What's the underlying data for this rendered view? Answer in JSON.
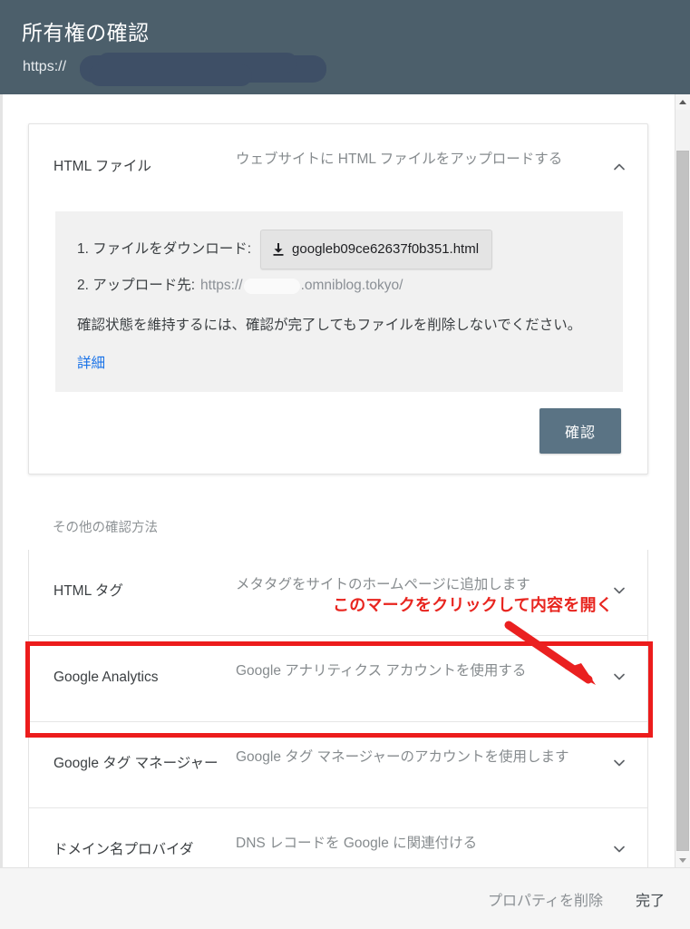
{
  "header": {
    "title": "所有権の確認",
    "url_prefix": "https://",
    "url_redacted": true
  },
  "main_card": {
    "title": "HTML ファイル",
    "description": "ウェブサイトに HTML ファイルをアップロードする",
    "chevron": "chevron-up-icon",
    "steps": {
      "step1_label": "1. ファイルをダウンロード:",
      "download_filename": "googleb09ce62637f0b351.html",
      "download_icon": "download-icon",
      "step2_label": "2. アップロード先:",
      "step2_url_prefix": "https://",
      "step2_url_suffix": ".omniblog.tokyo/"
    },
    "note": "確認状態を維持するには、確認が完了してもファイルを削除しないでください。",
    "details_link": "詳細",
    "confirm_button": "確認"
  },
  "other_methods": {
    "label": "その他の確認方法",
    "rows": [
      {
        "title": "HTML タグ",
        "description": "メタタグをサイトのホームページに追加します",
        "chevron": "chevron-down-icon",
        "highlighted": true
      },
      {
        "title": "Google Analytics",
        "description": "Google アナリティクス アカウントを使用する",
        "chevron": "chevron-down-icon",
        "highlighted": false
      },
      {
        "title": "Google タグ マネージャー",
        "description": "Google タグ マネージャーのアカウントを使用します",
        "chevron": "chevron-down-icon",
        "highlighted": false
      },
      {
        "title": "ドメイン名プロバイダ",
        "description": "DNS レコードを Google に関連付ける",
        "chevron": "chevron-down-icon",
        "highlighted": false
      }
    ]
  },
  "annotation": {
    "text": "このマークをクリックして内容を開く",
    "color": "#e8251f",
    "box_color": "#ec1c1c"
  },
  "footer": {
    "delete_property": "プロパティを削除",
    "done": "完了"
  },
  "colors": {
    "header_bg": "#4c5f6b",
    "confirm_button_bg": "#5a7384",
    "link_blue": "#1a73e8",
    "annotation_red": "#e8251f"
  }
}
